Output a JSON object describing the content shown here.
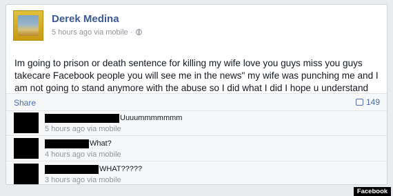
{
  "post": {
    "author": "Derek Medina",
    "meta": "5 hours ago via mobile ·",
    "text": "Im going to prison or death sentence for killing my wife love you guys miss you guys takecare Facebook people you will see me in the news\" my wife was punching me and I am not going to stand anymore with the abuse so I did what I did I hope u understand me \"",
    "share_label": "Share",
    "comment_count": "149"
  },
  "comments": [
    {
      "text": "Uuuummmmmmm",
      "time": "5 hours ago via mobile"
    },
    {
      "text": "What?",
      "time": "4 hours ago via mobile"
    },
    {
      "text": "WHAT?????",
      "time": "3 hours ago via mobile"
    }
  ],
  "badge": {
    "label": "Facebook"
  },
  "icons": {
    "privacy": "globe-icon",
    "comments": "comment-icon"
  },
  "colors": {
    "link": "#3b5998",
    "meta": "#90949c",
    "redaction": "#000000"
  }
}
